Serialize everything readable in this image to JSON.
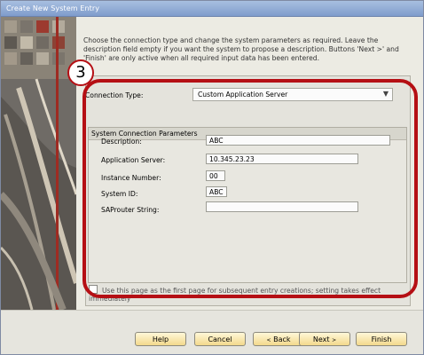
{
  "window": {
    "title": "Create New System Entry",
    "ghost_left": "",
    "ghost_mid": "",
    "ghost_right": ""
  },
  "intro_text": "Choose the connection type and change the system parameters as required. Leave the description field empty if you want the system to propose a description. Buttons 'Next >' and 'Finish' are only active when all required input data has been entered.",
  "step_number": "3",
  "connection": {
    "label": "Connection Type:",
    "value": "Custom Application Server"
  },
  "params": {
    "title": "System Connection Parameters",
    "fields": [
      {
        "label": "Description:",
        "value": "ABC"
      },
      {
        "label": "Application Server:",
        "value": "10.345.23.23"
      },
      {
        "label": "Instance Number:",
        "value": "00"
      },
      {
        "label": "System ID:",
        "value": "ABC"
      },
      {
        "label": "SAProuter String:",
        "value": ""
      }
    ]
  },
  "checkbox_label": "Use this page as the first page for subsequent entry creations; setting takes effect immediately",
  "buttons": {
    "help": "Help",
    "cancel": "Cancel",
    "back": "Back",
    "next": "Next",
    "finish": "Finish"
  },
  "colors": {
    "highlight": "#b50f14",
    "button_fill": "#f3d98c"
  }
}
